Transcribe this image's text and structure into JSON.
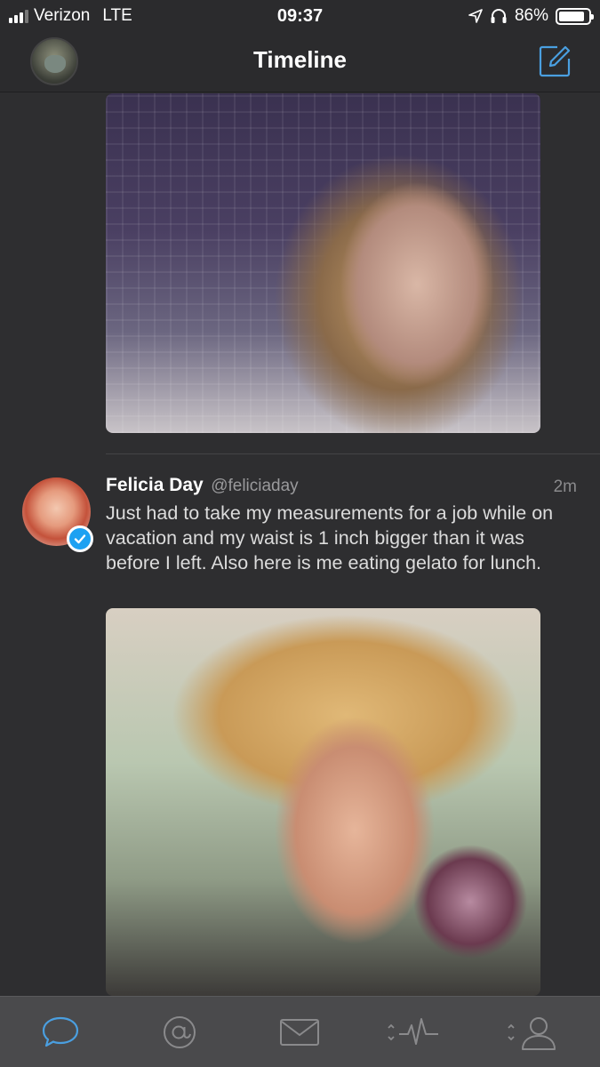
{
  "status_bar": {
    "carrier": "Verizon",
    "network": "LTE",
    "time": "09:37",
    "battery_percent": "86%",
    "battery_level": 0.86
  },
  "nav": {
    "title": "Timeline"
  },
  "tweet": {
    "name": "Felicia Day",
    "handle": "@feliciaday",
    "time": "2m",
    "text": "Just had to take my measurements for a job while on vacation and my waist is 1 inch bigger than it was before I left. Also here is me eating gelato for lunch."
  },
  "tab_bar": {
    "active_tab": "timeline",
    "active_color": "#4a9fe0",
    "inactive_color": "#8a8a8c",
    "icons": [
      "speech-bubble-icon",
      "at-sign-icon",
      "envelope-icon",
      "activity-icon",
      "profile-icon"
    ]
  }
}
